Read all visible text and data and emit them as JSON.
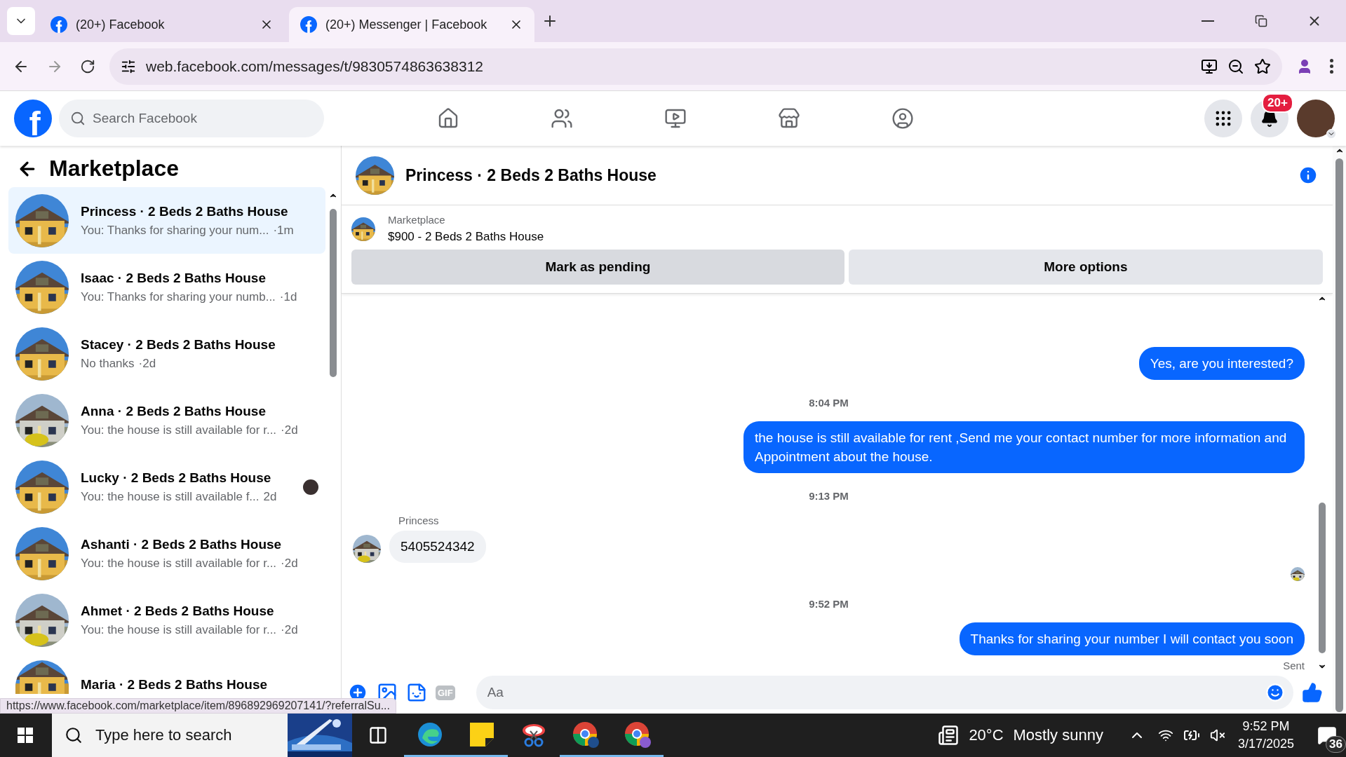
{
  "browser": {
    "tabs": [
      {
        "title": "(20+) Facebook",
        "selected": false
      },
      {
        "title": "(20+) Messenger | Facebook",
        "selected": true
      }
    ],
    "url": "web.facebook.com/messages/t/9830574863638312",
    "status_url": "https://www.facebook.com/marketplace/item/896892969207141/?referralSu..."
  },
  "header": {
    "logo_letter": "f",
    "search_placeholder": "Search Facebook",
    "nav": [
      {
        "kind": "home"
      },
      {
        "kind": "friends"
      },
      {
        "kind": "video"
      },
      {
        "kind": "marketplace"
      },
      {
        "kind": "groups"
      }
    ],
    "notification_badge": "20+"
  },
  "sidebar": {
    "title": "Marketplace",
    "conversations": [
      {
        "name": "Princess · 2 Beds 2 Baths House",
        "preview": "You: Thanks for sharing your num...",
        "time": "·1m",
        "selected": true,
        "seen": false
      },
      {
        "name": "Isaac · 2 Beds 2 Baths House",
        "preview": "You: Thanks for sharing your numb...",
        "time": "·1d",
        "selected": false,
        "seen": false
      },
      {
        "name": "Stacey · 2 Beds 2 Baths House",
        "preview": "No thanks",
        "time": "·2d",
        "selected": false,
        "seen": false
      },
      {
        "name": "Anna · 2 Beds 2 Baths House",
        "preview": "You: the house is still available for r...",
        "time": "·2d",
        "selected": false,
        "seen": false
      },
      {
        "name": "Lucky · 2 Beds 2 Baths House",
        "preview": "You: the house is still available f...",
        "time": "2d",
        "selected": false,
        "seen": true
      },
      {
        "name": "Ashanti · 2 Beds 2 Baths House",
        "preview": "You: the house is still available for r...",
        "time": "·2d",
        "selected": false,
        "seen": false
      },
      {
        "name": "Ahmet · 2 Beds 2 Baths House",
        "preview": "You: the house is still available for r...",
        "time": "·2d",
        "selected": false,
        "seen": false
      },
      {
        "name": "Maria · 2 Beds 2 Baths House",
        "selected": false,
        "seen": false
      }
    ]
  },
  "chat": {
    "title": "Princess · 2 Beds 2 Baths House",
    "listing": {
      "label": "Marketplace",
      "text": "$900 - 2 Beds 2 Baths House"
    },
    "actions": [
      "Mark as pending",
      "More options"
    ],
    "messages": [
      {
        "kind": "outgoing",
        "text": "Yes, are you interested?"
      },
      {
        "kind": "time",
        "text": "8:04 PM"
      },
      {
        "kind": "outgoing",
        "text": "the house is still available for rent ,Send me your contact number for more information and Appointment about the house."
      },
      {
        "kind": "time",
        "text": "9:13 PM"
      },
      {
        "kind": "incoming",
        "sender": "Princess",
        "text": "5405524342"
      },
      {
        "kind": "seen"
      },
      {
        "kind": "time",
        "text": "9:52 PM"
      },
      {
        "kind": "outgoing",
        "text": "Thanks for sharing your number I will contact you soon",
        "status": "Sent"
      }
    ],
    "composer": {
      "gif_label": "GIF",
      "placeholder": "Aa"
    }
  },
  "taskbar": {
    "search_placeholder": "Type here to search",
    "apps": [
      {
        "kind": "edge",
        "running": true
      },
      {
        "kind": "notes",
        "running": true
      },
      {
        "kind": "snip",
        "running": false
      },
      {
        "kind": "chrome",
        "running": true
      },
      {
        "kind": "chrome-profile",
        "running": true
      }
    ],
    "temperature": "20°C",
    "weather": "Mostly sunny",
    "time": "9:52 PM",
    "date": "3/17/2025",
    "notifications": "36"
  }
}
